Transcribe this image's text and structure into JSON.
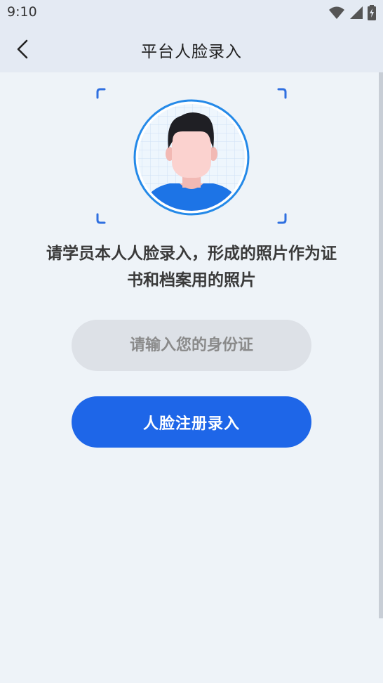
{
  "status_bar": {
    "time": "9:10",
    "icons": [
      "wifi-icon",
      "signal-icon",
      "battery-charging-icon"
    ]
  },
  "header": {
    "back_icon": "chevron-left-icon",
    "title": "平台人脸录入"
  },
  "face_preview": {
    "icon": "face-avatar-icon",
    "frame": "scan-frame-corners"
  },
  "instruction": {
    "line1": "请学员本人人脸录入，形成的照片作为证",
    "line2": "书和档案用的照片"
  },
  "id_input": {
    "value": "",
    "placeholder": "请输入您的身份证"
  },
  "register_button": {
    "label": "人脸注册录入"
  },
  "colors": {
    "primary": "#1e66e8",
    "background": "#eef3f8",
    "header_bg": "#e4eaf3",
    "input_bg": "#dde1e7"
  }
}
